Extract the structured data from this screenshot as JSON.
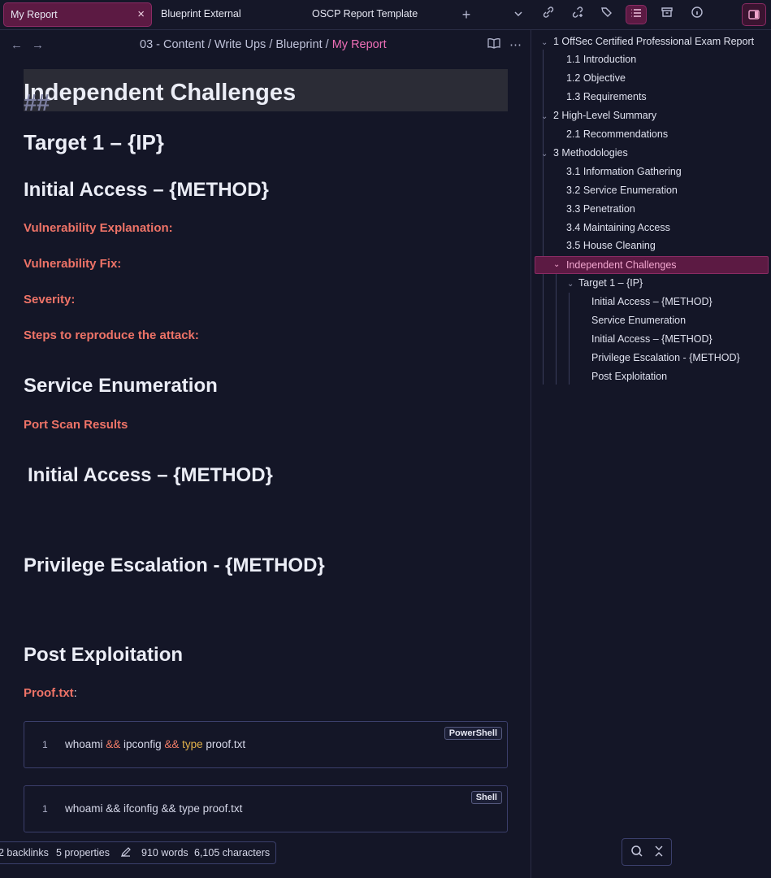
{
  "tabs": {
    "active": {
      "label": "My Report",
      "close": "×"
    },
    "others": [
      "Blueprint External",
      "OSCP Report Template"
    ],
    "new_tab": "+",
    "dropdown": "⌄"
  },
  "toolbar_icons": [
    "link-icon",
    "unlink-icon",
    "tags-icon",
    "outline-list-icon",
    "archive-icon",
    "info-icon",
    "sidebar-toggle-icon"
  ],
  "breadcrumb": {
    "parts": [
      "03 - Content",
      "Write Ups",
      "Blueprint"
    ],
    "separator": "/",
    "current": "My Report"
  },
  "document": {
    "h2_hash": "##",
    "h2": "Independent Challenges",
    "target": "Target 1 – {IP}",
    "initial_access_1": "Initial Access – {METHOD}",
    "vuln_explanation": "Vulnerability Explanation:",
    "vuln_fix": "Vulnerability Fix:",
    "severity": "Severity:",
    "steps": "Steps to reproduce the attack:",
    "service_enum": "Service Enumeration",
    "port_scan": "Port Scan Results",
    "initial_access_2": "Initial Access – {METHOD}",
    "priv_esc": "Privilege Escalation - {METHOD}",
    "post_exploit": "Post Exploitation",
    "proof_label": "Proof.txt",
    "proof_colon": ":",
    "code_blocks": [
      {
        "line": "1",
        "lang": "PowerShell",
        "parts": [
          "whoami ",
          "&&",
          " ipconfig ",
          "&&",
          " ",
          "type",
          " proof.txt"
        ]
      },
      {
        "line": "1",
        "lang": "Shell",
        "text": "whoami && ifconfig && type proof.txt"
      }
    ]
  },
  "status": {
    "backlinks": "2 backlinks",
    "properties": "5 properties",
    "words": "910 words",
    "characters": "6,105 characters"
  },
  "outline": {
    "items": [
      {
        "label": "1 OffSec Certified Professional Exam Report"
      },
      {
        "label": "1.1 Introduction"
      },
      {
        "label": "1.2 Objective"
      },
      {
        "label": "1.3 Requirements"
      },
      {
        "label": "2 High-Level Summary"
      },
      {
        "label": "2.1 Recommendations"
      },
      {
        "label": "3 Methodologies"
      },
      {
        "label": "3.1 Information Gathering"
      },
      {
        "label": "3.2 Service Enumeration"
      },
      {
        "label": "3.3 Penetration"
      },
      {
        "label": "3.4 Maintaining Access"
      },
      {
        "label": "3.5 House Cleaning"
      },
      {
        "label": "Independent Challenges"
      },
      {
        "label": "Target 1 – {IP}"
      },
      {
        "label": "Initial Access – {METHOD}"
      },
      {
        "label": "Service Enumeration"
      },
      {
        "label": "Initial Access – {METHOD}"
      },
      {
        "label": "Privilege Escalation - {METHOD}"
      },
      {
        "label": "Post Exploitation"
      }
    ]
  },
  "colors": {
    "accent": "#5c1a43",
    "heading_red": "#ee7367",
    "link_pink": "#ee6fb7",
    "background": "#141627"
  }
}
